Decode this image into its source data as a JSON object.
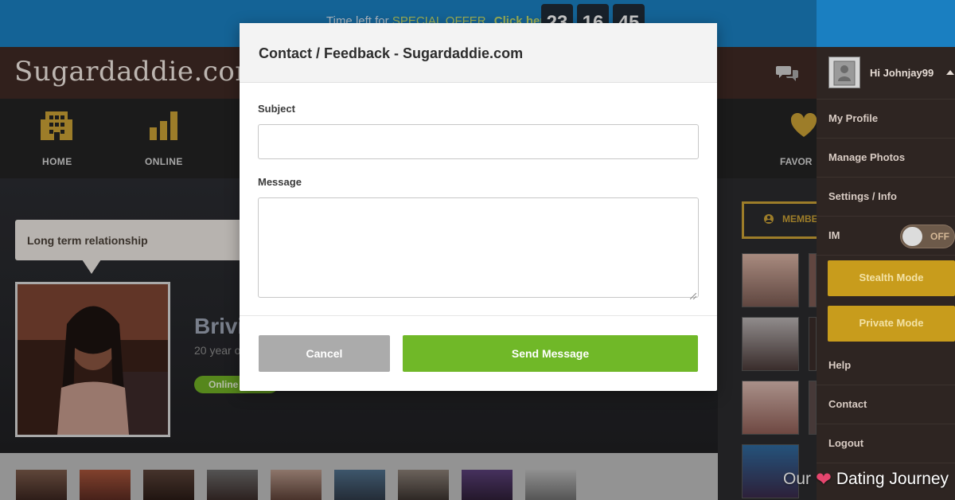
{
  "promo": {
    "text": "Time left for",
    "offer": "SPECIAL OFFER",
    "click": "Click here",
    "timer": [
      "23",
      "16",
      "45"
    ]
  },
  "header": {
    "logo": "Sugardaddie.com"
  },
  "nav": {
    "items": [
      {
        "label": "HOME",
        "icon": "building-icon"
      },
      {
        "label": "ONLINE",
        "icon": "bar-chart-icon"
      },
      {
        "label": "FAVOR",
        "icon": "heart-icon"
      }
    ]
  },
  "profile": {
    "relationship": "Long term relationship",
    "name": "Brivi",
    "age": "20 year o",
    "status": "Online"
  },
  "sidebar": {
    "members_label": "MEMBE"
  },
  "user_menu": {
    "greeting": "Hi Johnjay99",
    "items": [
      "My Profile",
      "Manage Photos",
      "Settings / Info"
    ],
    "im_label": "IM",
    "im_toggle": "OFF",
    "stealth": "Stealth Mode",
    "private": "Private Mode",
    "items_bottom": [
      "Help",
      "Contact",
      "Logout"
    ]
  },
  "modal": {
    "title": "Contact / Feedback - Sugardaddie.com",
    "subject_label": "Subject",
    "subject_value": "",
    "message_label": "Message",
    "message_value": "",
    "cancel": "Cancel",
    "send": "Send Message"
  },
  "watermark": {
    "left": "Our",
    "right": "Dating Journey"
  },
  "colors": {
    "promo_bg": "#1a7fc1",
    "send_green": "#70b828",
    "gold": "#c89c1c",
    "header_brown": "#3f2a24"
  }
}
